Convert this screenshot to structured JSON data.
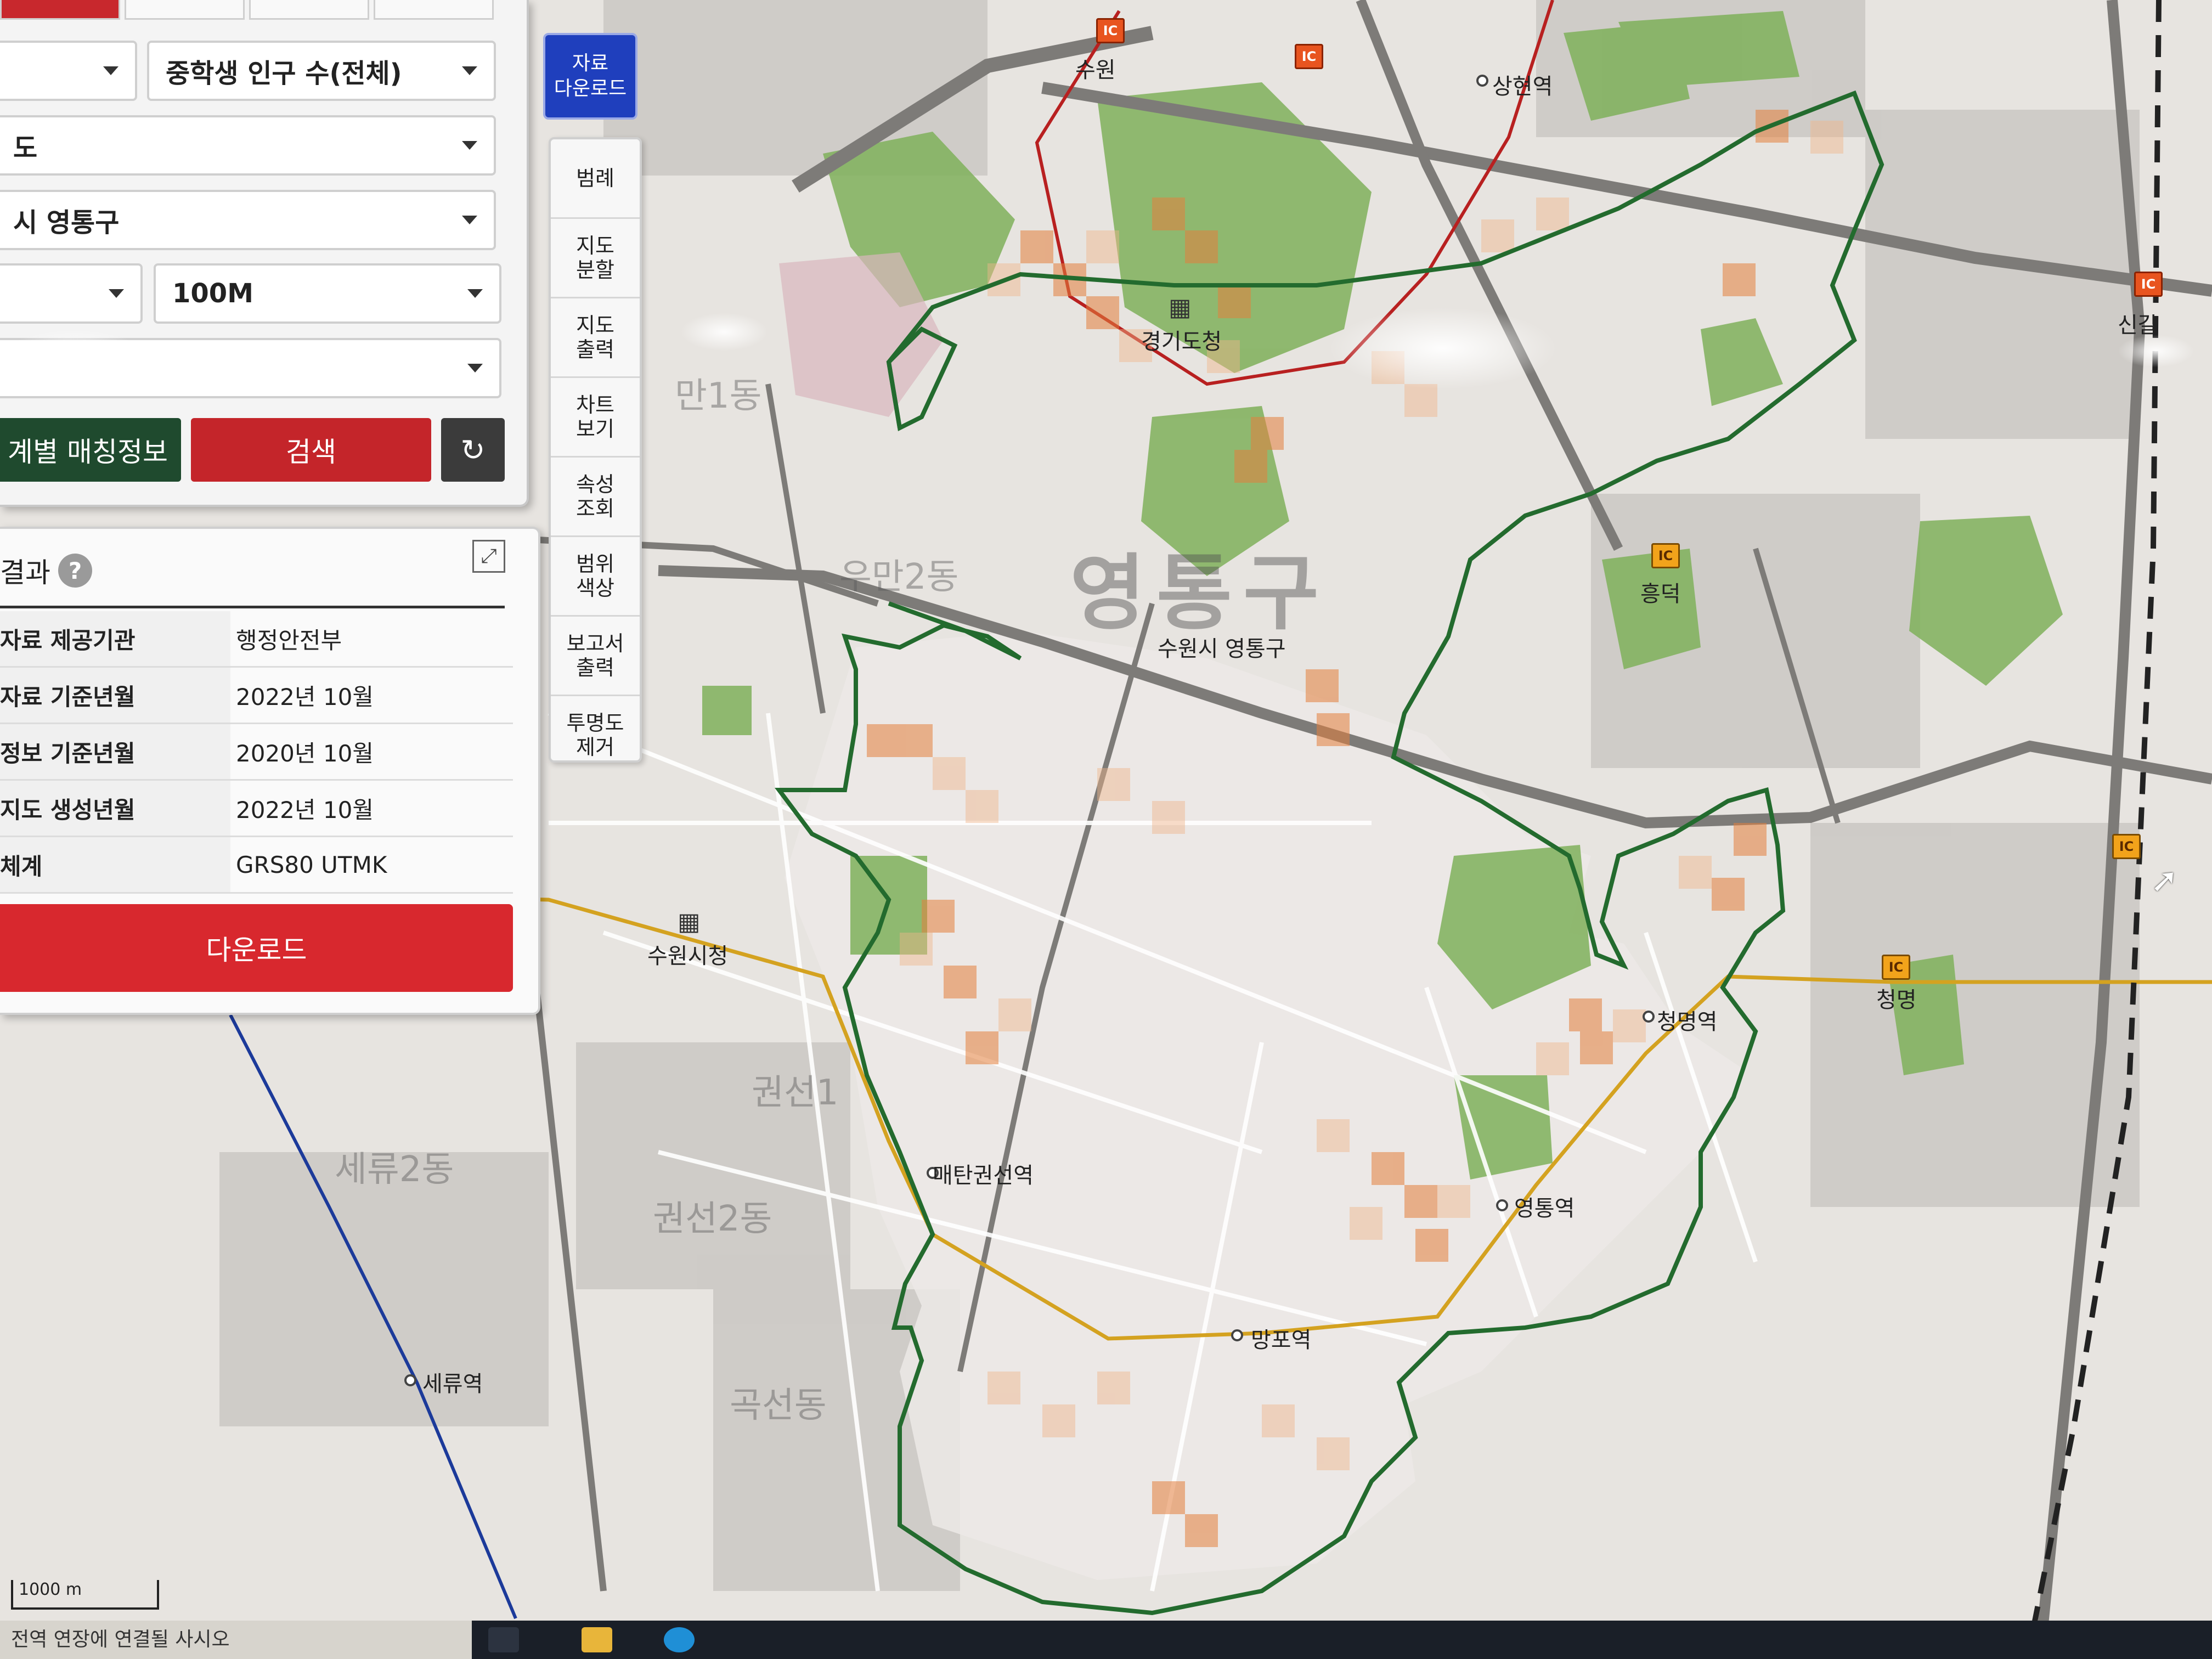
{
  "controls": {
    "indicator_select": "중학생 인구 수(전체)",
    "region_select_1": "도",
    "region_select_2": "시 영통구",
    "grid_select": "100M",
    "period_select": "",
    "matching_button": "계별 매칭정보",
    "search_button": "검색",
    "download_tile": "자료\n다운로드"
  },
  "tools": [
    {
      "label": "범례"
    },
    {
      "label": "지도\n분할"
    },
    {
      "label": "지도\n출력"
    },
    {
      "label": "차트\n보기"
    },
    {
      "label": "속성\n조회"
    },
    {
      "label": "범위\n색상"
    },
    {
      "label": "보고서\n출력"
    },
    {
      "label": "투명도\n제거"
    }
  ],
  "results": {
    "heading": "결과",
    "rows": [
      {
        "key": "자료 제공기관",
        "value": "행정안전부"
      },
      {
        "key": "자료 기준년월",
        "value": "2022년 10월"
      },
      {
        "key": "정보 기준년월",
        "value": "2020년 10월"
      },
      {
        "key": "지도 생성년월",
        "value": "2022년 10월"
      },
      {
        "key": "체계",
        "value": "GRS80 UTMK"
      }
    ],
    "download_button": "다운로드"
  },
  "map": {
    "district_big_label": "영통구",
    "district_label": "수원시 영통구",
    "labels": [
      {
        "id": "gyeonggi-office",
        "text": "경기도청"
      },
      {
        "id": "suwon-city-hall",
        "text": "수원시청"
      },
      {
        "id": "maetan-station",
        "text": "매탄권선역"
      },
      {
        "id": "mangpo-station",
        "text": "망포역"
      },
      {
        "id": "yeongtong-station",
        "text": "영통역"
      },
      {
        "id": "cheongmyeong-station",
        "text": "청명역"
      },
      {
        "id": "cheongmyeong",
        "text": "청명"
      },
      {
        "id": "heungdeok",
        "text": "흥덕"
      },
      {
        "id": "sanghyeon-station",
        "text": "상현역"
      },
      {
        "id": "seryu-station",
        "text": "세류역"
      },
      {
        "id": "suwon-ic",
        "text": "수원"
      },
      {
        "id": "singal",
        "text": "신갈"
      }
    ],
    "faint_labels": [
      {
        "id": "uman1",
        "text": "만1동"
      },
      {
        "id": "uman2",
        "text": "우만2동"
      },
      {
        "id": "seryu2",
        "text": "세류2동"
      },
      {
        "id": "gwonseon2",
        "text": "권선2동"
      },
      {
        "id": "gokseon",
        "text": "곡선동"
      },
      {
        "id": "gwonseon1",
        "text": "권선1"
      }
    ],
    "ic_badge": "IC",
    "scale": "1000 m"
  },
  "taskbar": {
    "ticker": "전역 연장에 연결될 사시오"
  }
}
